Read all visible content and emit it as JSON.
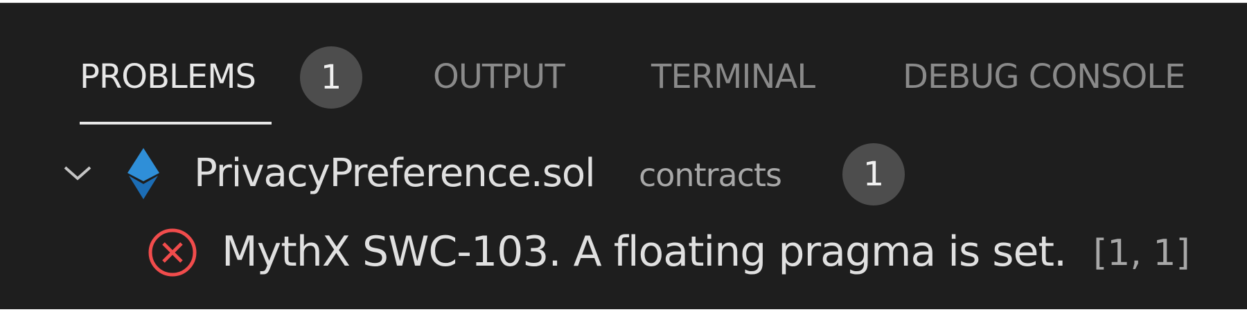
{
  "panel": {
    "tabs": [
      {
        "label": "PROBLEMS",
        "active": true,
        "badge": "1"
      },
      {
        "label": "OUTPUT",
        "active": false
      },
      {
        "label": "TERMINAL",
        "active": false
      },
      {
        "label": "DEBUG CONSOLE",
        "active": false
      }
    ]
  },
  "problems": {
    "file": {
      "name": "PrivacyPreference.sol",
      "folder": "contracts",
      "count": "1",
      "expand_icon": "chevron-down-icon",
      "file_icon": "ethereum-icon"
    },
    "items": [
      {
        "severity_icon": "error-icon",
        "message": "MythX SWC-103. A floating pragma is set.",
        "position": "[1, 1]"
      }
    ]
  },
  "colors": {
    "panel_background": "#1e1e1e",
    "active_tab": "#e7e7e7",
    "inactive_tab": "#8a8a8a",
    "badge_background": "#4d4d4d",
    "error": "#f14c4c",
    "ethereum": "#2f8fd8"
  }
}
